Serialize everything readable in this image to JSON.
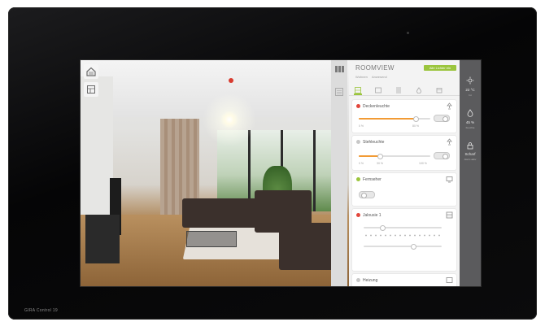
{
  "brand": {
    "label": "GIRA Control 19"
  },
  "room": {
    "title": "ROOMVIEW",
    "sub_left": "Wohnen",
    "sub_right": "Anwesend",
    "status": "Alle Lichter ein"
  },
  "tabs": [
    "scene-tab",
    "light-tab",
    "blind-tab",
    "climate-tab",
    "misc-tab"
  ],
  "cards": {
    "light1": {
      "title": "Deckenleuchte",
      "value_label": "80 %",
      "min_label": "0 %",
      "level": 0.8,
      "color": "#e2473c"
    },
    "light2": {
      "title": "Stehleuchte",
      "value_label": "30 %",
      "min_label": "0 %",
      "max_label": "100 %",
      "level": 0.3,
      "color": "#b5b5b5"
    },
    "tv": {
      "title": "Fernseher",
      "color": "#9bc53d"
    },
    "blind": {
      "title": "Jalousie 1",
      "color": "#e2473c"
    },
    "heating": {
      "title": "Heizung",
      "color": "#b5b5b5"
    }
  },
  "strip": {
    "temp": "22 °C",
    "temp_label": "Ist",
    "humidity": "45 %",
    "humidity_label": "Feuchte",
    "lock": "Scharf",
    "lock_label": "Alarm aktiv"
  },
  "colors": {
    "accent": "#9bc53d",
    "warm": "#f29b35",
    "panel": "#f3f3f3",
    "strip": "#5b5b5d"
  }
}
